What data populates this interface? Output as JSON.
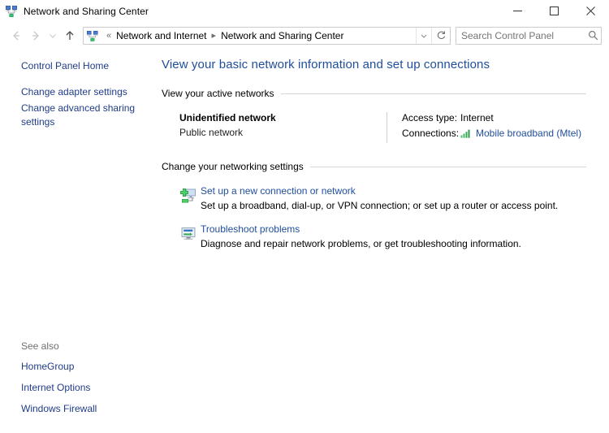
{
  "window": {
    "title": "Network and Sharing Center",
    "icon": "network-sharing-icon",
    "minimize_label": "─",
    "maximize_label": "□",
    "close_label": "✕"
  },
  "nav": {
    "back_label": "←",
    "forward_label": "→",
    "recent_label": "⌄",
    "up_label": "↑",
    "address_icon": "network-sharing-icon",
    "double_chevron": "«",
    "crumbs": [
      "Network and Internet",
      "Network and Sharing Center"
    ],
    "separator": "▸",
    "dropdown_label": "⌄",
    "refresh_label": "↻"
  },
  "search": {
    "placeholder": "Search Control Panel",
    "value": "",
    "icon": "search-icon"
  },
  "sidebar": {
    "home_link": "Control Panel Home",
    "links": [
      "Change adapter settings",
      "Change advanced sharing settings"
    ],
    "see_also_title": "See also",
    "see_also_links": [
      "HomeGroup",
      "Internet Options",
      "Windows Firewall"
    ]
  },
  "main": {
    "page_title": "View your basic network information and set up connections",
    "active_networks_heading": "View your active networks",
    "network": {
      "name": "Unidentified network",
      "type": "Public network",
      "access_type_key": "Access type:",
      "access_type_value": "Internet",
      "connections_key": "Connections:",
      "connections_value": "Mobile broadband (Mtel)",
      "connections_icon": "signal-bars-icon"
    },
    "settings_heading": "Change your networking settings",
    "tasks": [
      {
        "icon": "new-connection-icon",
        "title": "Set up a new connection or network",
        "description": "Set up a broadband, dial-up, or VPN connection; or set up a router or access point."
      },
      {
        "icon": "troubleshoot-icon",
        "title": "Troubleshoot problems",
        "description": "Diagnose and repair network problems, or get troubleshooting information."
      }
    ]
  },
  "colors": {
    "link": "#1f4e9c",
    "sidebar_link": "#1f3c88",
    "title": "#1f4e9c",
    "signal_green": "#3fa34d",
    "rule": "#d6d6d6"
  }
}
